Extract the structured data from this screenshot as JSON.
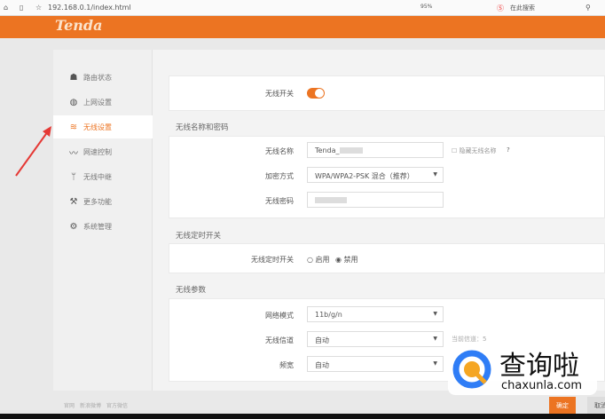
{
  "browser": {
    "url": "192.168.0.1/index.html",
    "zoom": "95%",
    "search_placeholder": "在此搜索"
  },
  "header": {
    "logo": "Tenda"
  },
  "sidebar": {
    "items": [
      {
        "label": "路由状态",
        "icon": "router-icon"
      },
      {
        "label": "上网设置",
        "icon": "globe-icon"
      },
      {
        "label": "无线设置",
        "icon": "wifi-icon",
        "active": true
      },
      {
        "label": "网速控制",
        "icon": "speed-icon"
      },
      {
        "label": "无线中继",
        "icon": "repeater-icon"
      },
      {
        "label": "更多功能",
        "icon": "tools-icon"
      },
      {
        "label": "系统管理",
        "icon": "gear-icon"
      }
    ],
    "footer": [
      "官网",
      "新浪微博",
      "官方微信"
    ]
  },
  "main": {
    "wifi_switch": {
      "label": "无线开关",
      "on": true
    },
    "name_pwd": {
      "title": "无线名称和密码",
      "ssid_label": "无线名称",
      "ssid_value": "Tenda_",
      "hide_label": "隐藏无线名称",
      "help": "?",
      "enc_label": "加密方式",
      "enc_value": "WPA/WPA2-PSK 混合（推荐）",
      "pwd_label": "无线密码"
    },
    "timer": {
      "title": "无线定时开关",
      "label": "无线定时开关",
      "opt_on": "启用",
      "opt_off": "禁用",
      "selected": "禁用"
    },
    "params": {
      "title": "无线参数",
      "mode_label": "网络模式",
      "mode_value": "11b/g/n",
      "channel_label": "无线信道",
      "channel_value": "自动",
      "current_channel": "当前信道：5",
      "bw_label": "频宽",
      "bw_value": "自动"
    },
    "ok_label": "确定",
    "cancel_label": "取消"
  },
  "watermark": {
    "text": "查询啦",
    "domain": "chaxunla.com"
  }
}
